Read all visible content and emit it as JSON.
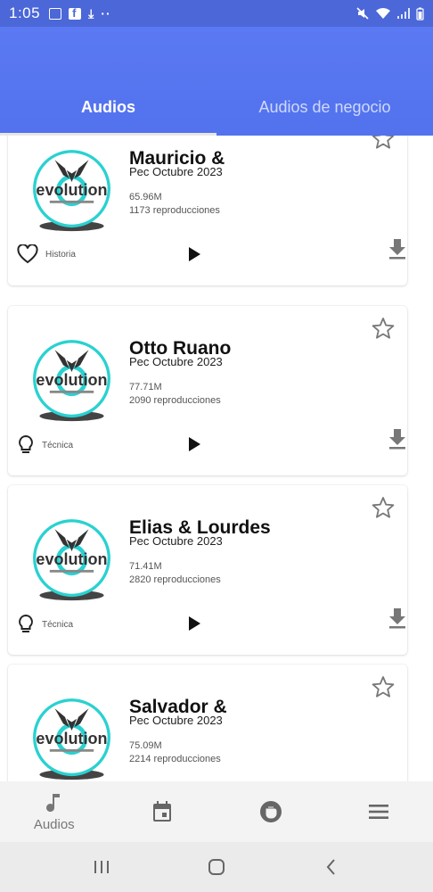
{
  "status_bar": {
    "time": "1:05"
  },
  "tabs": [
    {
      "label": "Audios",
      "active": true
    },
    {
      "label": "Audios de negocio",
      "active": false
    }
  ],
  "logo_text": "evolution",
  "audios": [
    {
      "title": "Mauricio &",
      "subtitle": "Pec Octubre 2023",
      "size": "65.96M",
      "plays": "1173 reproducciones",
      "category": "Historia",
      "category_icon": "heart-icon"
    },
    {
      "title": "Otto Ruano",
      "subtitle": "Pec Octubre 2023",
      "size": "77.71M",
      "plays": "2090 reproducciones",
      "category": "Técnica",
      "category_icon": "lightbulb-icon"
    },
    {
      "title": "Elias & Lourdes",
      "subtitle": "Pec Octubre 2023",
      "size": "71.41M",
      "plays": "2820 reproducciones",
      "category": "Técnica",
      "category_icon": "lightbulb-icon"
    },
    {
      "title": "Salvador &",
      "subtitle": "Pec Octubre 2023",
      "size": "75.09M",
      "plays": "2214 reproducciones",
      "category": "",
      "category_icon": ""
    }
  ],
  "bottom_nav": [
    {
      "label": "Audios",
      "icon": "music-note-icon"
    },
    {
      "label": "",
      "icon": "calendar-icon"
    },
    {
      "label": "",
      "icon": "fist-icon"
    },
    {
      "label": "",
      "icon": "menu-icon"
    }
  ],
  "colors": {
    "app_bar": "#5a79f2",
    "accent_cyan": "#2ad1d1",
    "status_bar": "#4b67d8"
  }
}
